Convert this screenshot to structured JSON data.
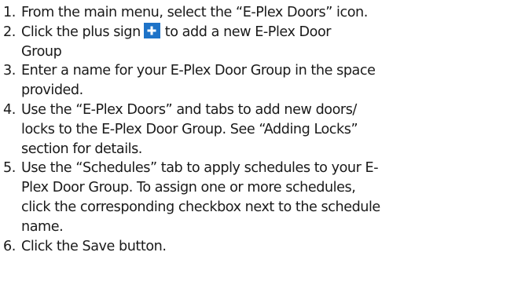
{
  "steps": [
    {
      "number": "1.",
      "lines": [
        "From the main menu, select the “E-Plex Doors” icon."
      ]
    },
    {
      "number": "2.",
      "before_icon": "Click the plus sign",
      "icon": "plus-icon",
      "after_icon": "to add a new E-Plex Door",
      "lines": [
        "Group"
      ]
    },
    {
      "number": "3.",
      "lines": [
        "Enter a name for your E-Plex Door Group in the space",
        "provided."
      ]
    },
    {
      "number": "4.",
      "lines": [
        "Use the “E-Plex Doors” and tabs to add new doors/",
        "locks to the E-Plex Door Group.  See “Adding Locks”",
        "section for details."
      ]
    },
    {
      "number": "5.",
      "lines": [
        "Use the “Schedules” tab to apply schedules to your E-",
        "Plex Door Group.  To assign one or more schedules,",
        "click the corresponding checkbox next to the schedule",
        "name."
      ]
    },
    {
      "number": "6.",
      "lines": [
        "Click the Save button."
      ]
    }
  ],
  "colors": {
    "text": "#1a1a1a",
    "plus_icon_bg": "#1e73c8",
    "plus_icon_fg": "#ffffff"
  }
}
